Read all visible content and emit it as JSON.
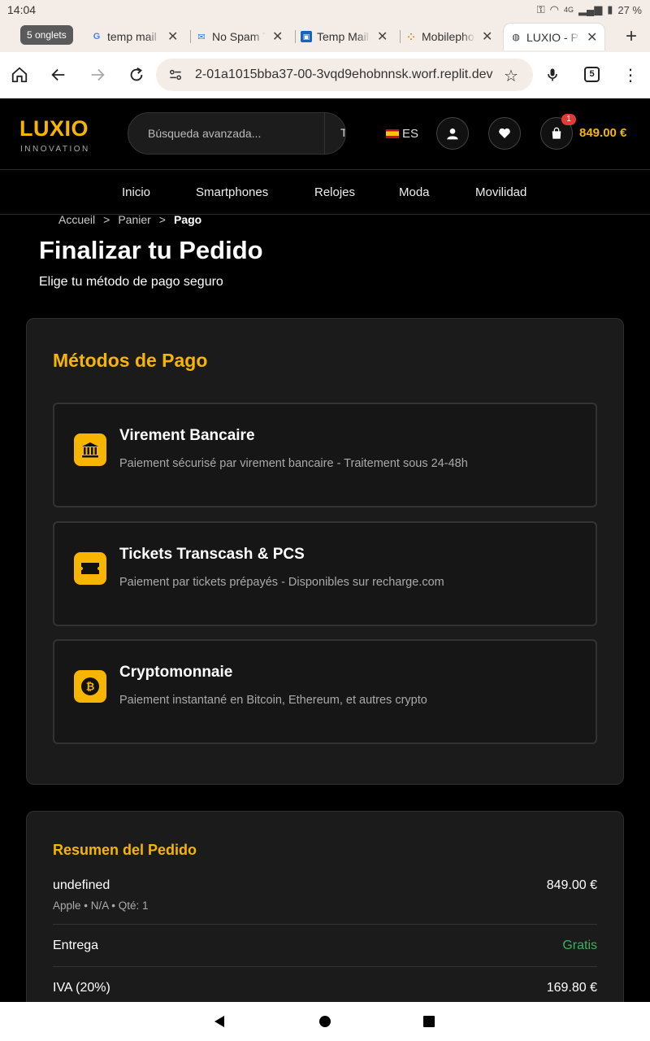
{
  "status": {
    "time": "14:04",
    "network": "4G",
    "battery": "27 %"
  },
  "tabs": {
    "count_label": "5 onglets",
    "items": [
      {
        "title": "temp mail",
        "icon": "google-icon"
      },
      {
        "title": "No Spam T",
        "icon": "mail-icon"
      },
      {
        "title": "Temp Mail",
        "icon": "tempmail-icon"
      },
      {
        "title": "Mobilepho",
        "icon": "mobile-icon"
      },
      {
        "title": "LUXIO - Pa",
        "icon": "globe-icon"
      }
    ]
  },
  "toolbar": {
    "url": "2-01a1015bba37-00-3vqd9ehobnnsk.worf.replit.dev",
    "tab_count": "5"
  },
  "site": {
    "logo": "LUXIO",
    "logo_sub": "INNOVATION",
    "search_placeholder": "Búsqueda avanzada...",
    "search_button": "T",
    "lang": "ES",
    "cart_badge": "1",
    "cart_total": "849.00 €"
  },
  "nav": [
    "Inicio",
    "Smartphones",
    "Relojes",
    "Moda",
    "Movilidad"
  ],
  "breadcrumb": {
    "home": "Accueil",
    "sep": ">",
    "cart": "Panier",
    "current": "Pago"
  },
  "page": {
    "title": "Finalizar tu Pedido",
    "subtitle": "Elige tu método de pago seguro"
  },
  "payment": {
    "heading": "Métodos de Pago",
    "methods": [
      {
        "title": "Virement Bancaire",
        "desc": "Paiement sécurisé par virement bancaire - Traitement sous 24-48h",
        "icon": "bank-icon"
      },
      {
        "title": "Tickets Transcash & PCS",
        "desc": "Paiement par tickets prépayés - Disponibles sur recharge.com",
        "icon": "ticket-icon"
      },
      {
        "title": "Cryptomonnaie",
        "desc": "Paiement instantané en Bitcoin, Ethereum, et autres crypto",
        "icon": "bitcoin-icon"
      }
    ]
  },
  "summary": {
    "heading": "Resumen del Pedido",
    "item": {
      "name": "undefined",
      "meta": "Apple • N/A • Qté: 1",
      "price": "849.00 €"
    },
    "delivery": {
      "label": "Entrega",
      "value": "Gratis"
    },
    "vat": {
      "label": "IVA (20%)",
      "value": "169.80 €"
    }
  },
  "colors": {
    "accent": "#f7b500",
    "free": "#3fae5a",
    "background": "#000000",
    "card": "#1b1b1b"
  }
}
